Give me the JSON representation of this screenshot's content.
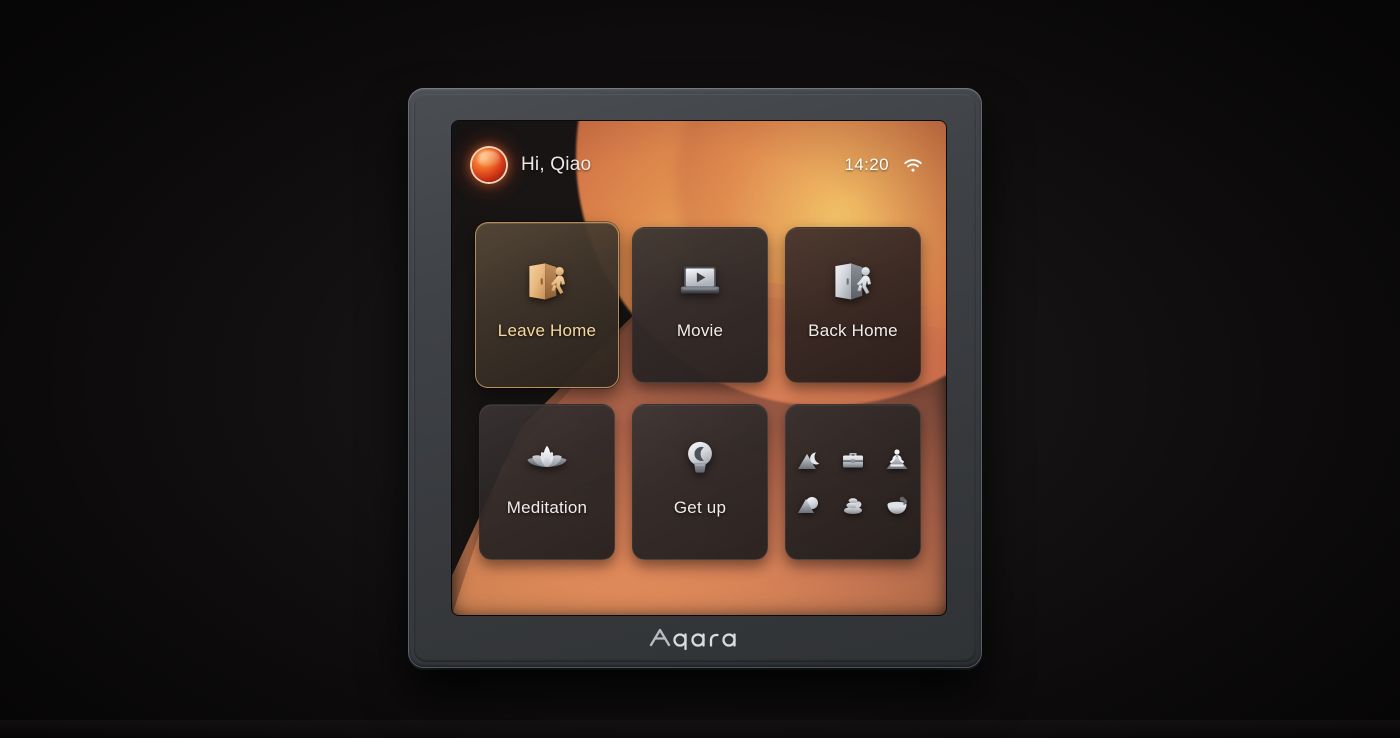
{
  "device": {
    "brand": "Aqara",
    "brand_logo_icon": "aqara-wordmark"
  },
  "screen": {
    "statusbar": {
      "avatar_icon": "user-avatar-orb",
      "greeting": "Hi, Qiao",
      "time": "14:20",
      "wifi_icon": "wifi-icon",
      "wifi_level": 3
    },
    "scenes": [
      {
        "id": "leave-home",
        "label": "Leave Home",
        "icon": "door-person-exit-icon",
        "selected": true,
        "style": "warm"
      },
      {
        "id": "movie",
        "label": "Movie",
        "icon": "monitor-play-icon",
        "selected": false,
        "style": "dark"
      },
      {
        "id": "back-home",
        "label": "Back Home",
        "icon": "door-person-enter-icon",
        "selected": false,
        "style": "warm"
      },
      {
        "id": "meditation",
        "label": "Meditation",
        "icon": "lotus-flower-icon",
        "selected": false,
        "style": "dark"
      },
      {
        "id": "get-up",
        "label": "Get up",
        "icon": "bulb-moon-icon",
        "selected": false,
        "style": "dark"
      }
    ],
    "scene_library": {
      "id": "more-scenes",
      "icons": [
        "night-mountain-moon-icon",
        "briefcase-icon",
        "meditation-figure-icon",
        "sunrise-mountain-icon",
        "zen-stones-icon",
        "tea-pot-icon"
      ]
    }
  },
  "colors": {
    "accent_selected_border": "#e2b06c",
    "accent_selected_text": "#f7d9a0",
    "tile_background": "#2c2727",
    "screen_background": "#171313",
    "wallpaper_warm": "#e08c4e",
    "wallpaper_highlight": "#f0b55e",
    "bezel": "#3f4247",
    "text_primary": "#f0ece9"
  }
}
